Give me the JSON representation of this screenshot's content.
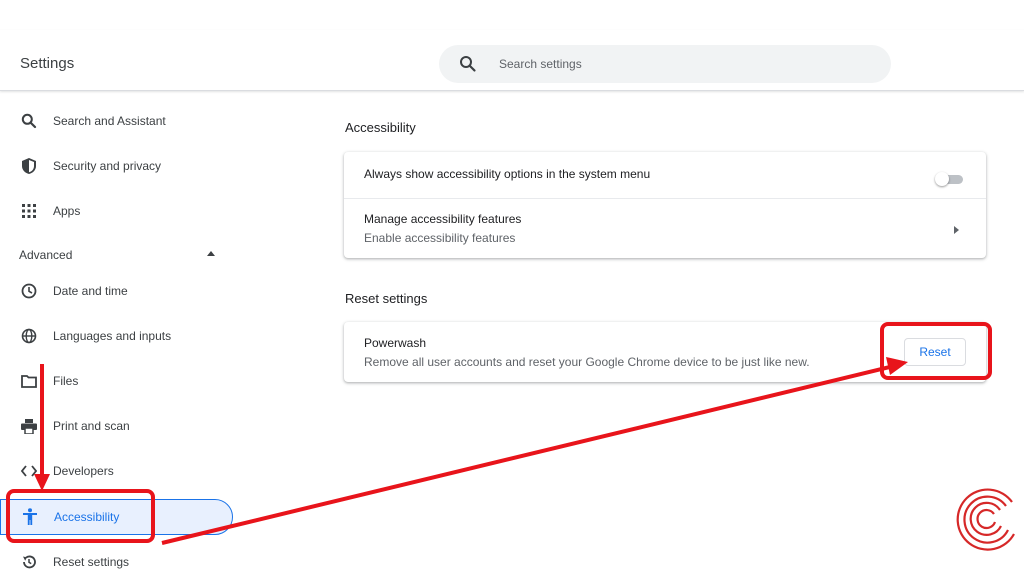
{
  "header": {
    "title": "Settings",
    "search": {
      "placeholder": "Search settings",
      "value": ""
    }
  },
  "sidebar": {
    "items": [
      {
        "label": "Search and Assistant",
        "icon": "search-icon"
      },
      {
        "label": "Security and privacy",
        "icon": "shield-icon"
      },
      {
        "label": "Apps",
        "icon": "apps-grid-icon"
      }
    ],
    "advanced": {
      "label": "Advanced",
      "icon": "caret-up-icon"
    },
    "advanced_items": [
      {
        "label": "Date and time",
        "icon": "clock-icon"
      },
      {
        "label": "Languages and inputs",
        "icon": "globe-icon"
      },
      {
        "label": "Files",
        "icon": "folder-icon"
      },
      {
        "label": "Print and scan",
        "icon": "printer-icon"
      },
      {
        "label": "Developers",
        "icon": "code-icon"
      },
      {
        "label": "Accessibility",
        "icon": "accessibility-icon",
        "active": true
      },
      {
        "label": "Reset settings",
        "icon": "history-icon"
      }
    ]
  },
  "main": {
    "accessibility": {
      "title": "Accessibility",
      "rows": [
        {
          "title": "Always show accessibility options in the system menu",
          "toggle": false
        },
        {
          "title": "Manage accessibility features",
          "subtitle": "Enable accessibility features"
        }
      ]
    },
    "reset": {
      "title": "Reset settings",
      "powerwash": {
        "title": "Powerwash",
        "subtitle": "Remove all user accounts and reset your Google Chrome device to be just like new.",
        "button": "Reset"
      }
    }
  },
  "colors": {
    "accent": "#1a73e8",
    "active_bg": "#e8f0fe",
    "annotation": "#e8141b",
    "text": "#202124",
    "secondary_text": "#5f6368"
  }
}
